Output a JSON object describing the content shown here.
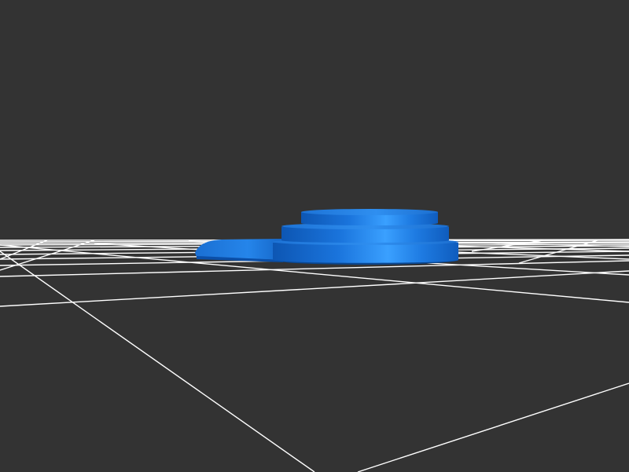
{
  "scene": {
    "background_color": "#333333",
    "grid_color": "#ffffff",
    "model_color": "#1f7fe6",
    "model_highlight_color": "#3fa2ff",
    "model_shadow_color": "#0b4fa8",
    "model": {
      "name": "stepped-disc-model",
      "tiers": 3,
      "has_handle": true
    }
  }
}
